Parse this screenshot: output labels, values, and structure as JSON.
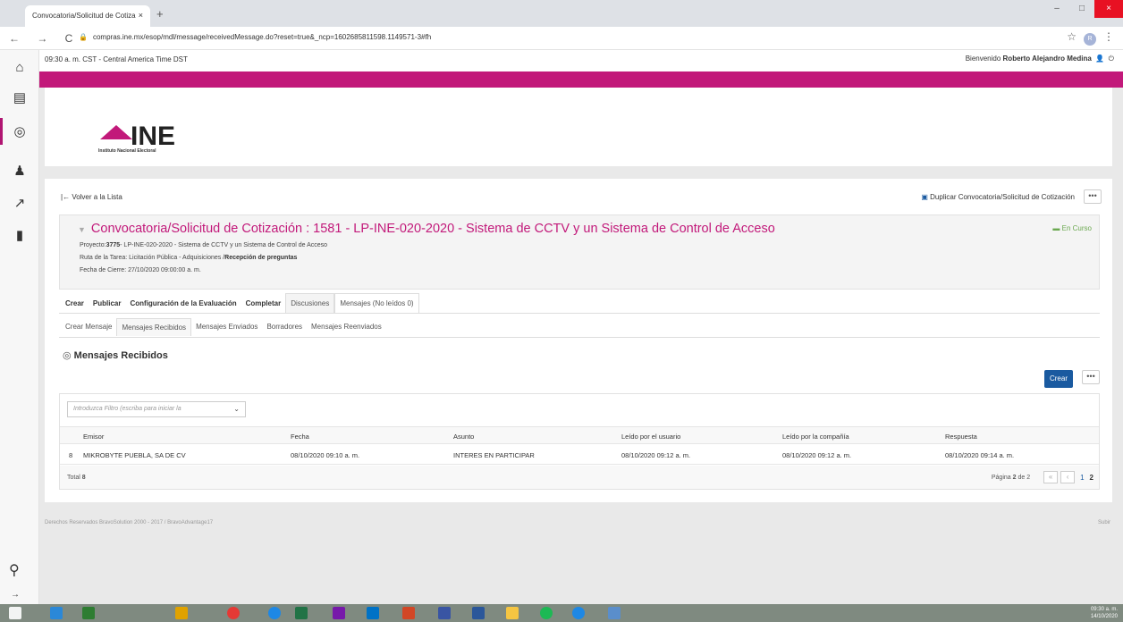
{
  "browser": {
    "tab_title": "Convocatoria/Solicitud de Cotiza",
    "tab_close": "×",
    "new_tab": "+",
    "url": "compras.ine.mx/esop/mdl/message/receivedMessage.do?reset=true&_ncp=1602685811598.1149571-3#fh",
    "nav": "← → C",
    "profile_initial": "R",
    "window_controls": [
      "–",
      "□",
      "×"
    ]
  },
  "top": {
    "timezone": "09:30 a. m. CST - Central America Time DST",
    "welcome_prefix": "Bienvenido",
    "user_name": "Roberto Alejandro Medina"
  },
  "logo": {
    "text": "INE",
    "subtitle": "Instituto Nacional Electoral"
  },
  "page": {
    "back_label": "Volver a la Lista",
    "duplicate_label": "Duplicar Convocatoria/Solicitud de Cotización",
    "title": "Convocatoria/Solicitud de Cotización : 1581 - LP-INE-020-2020 - Sistema de CCTV y un Sistema de Control de Acceso",
    "status": "En Curso",
    "project_label": "Proyecto:",
    "project_id": "3775",
    "project_rest": "- LP-INE-020-2020 - Sistema de CCTV y un Sistema de Control de Acceso",
    "route_label": "Ruta de la Tarea: Licitación Pública - Adquisiciones /",
    "route_value": "Recepción de preguntas",
    "close_date": "Fecha de Cierre: 27/10/2020 09:00:00 a. m."
  },
  "tabs_main": [
    "Crear",
    "Publicar",
    "Configuración de la Evaluación",
    "Completar",
    "Discusiones",
    "Mensajes (No leídos 0)"
  ],
  "tabs_sub": [
    "Crear Mensaje",
    "Mensajes Recibidos",
    "Mensajes Enviados",
    "Borradores",
    "Mensajes Reenviados"
  ],
  "section": {
    "title": "Mensajes Recibidos",
    "create_button": "Crear",
    "more": "•••"
  },
  "table": {
    "filter_placeholder": "Introduzca Filtro (escriba para iniciar la",
    "headers": [
      "Emisor",
      "Fecha",
      "Asunto",
      "Leído por el usuario",
      "Leído por la compañía",
      "Respuesta"
    ],
    "rows": [
      {
        "num": "8",
        "emisor": "MIKROBYTE PUEBLA, SA DE CV",
        "fecha": "08/10/2020 09:10 a. m.",
        "asunto": "INTERES EN PARTICIPAR",
        "leido_usuario": "08/10/2020 09:12 a. m.",
        "leido_compania": "08/10/2020 09:12 a. m.",
        "respuesta": "08/10/2020 09:14 a. m."
      }
    ],
    "total_label": "Total",
    "total_value": "8",
    "page_label": "Página",
    "page_current": "2",
    "page_of": "de 2",
    "pages": [
      "1",
      "2"
    ]
  },
  "footer": {
    "copyright": "Derechos Reservados BravoSolution 2000 - 2017 / BravoAdvantage17",
    "up": "Subir"
  },
  "taskbar": {
    "time": "09:30 a. m.",
    "date": "14/10/2020"
  },
  "colors": {
    "brand": "#c2197a",
    "primary_button": "#1a5aa0",
    "status": "#6aa84f"
  }
}
